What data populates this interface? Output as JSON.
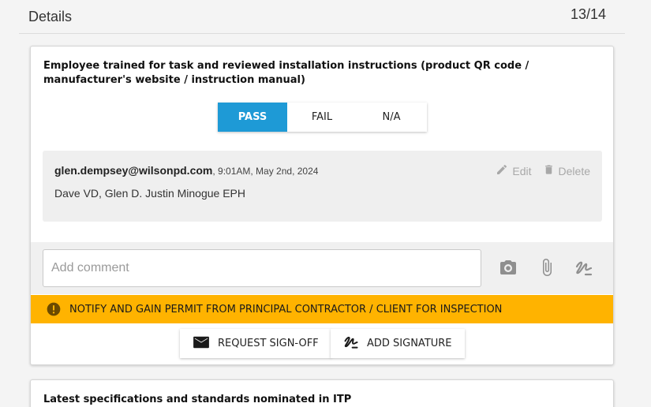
{
  "header": {
    "title": "Details",
    "count": "13/14"
  },
  "item": {
    "question": "Employee trained for task and reviewed installation instructions (product QR code / manufacturer's website / instruction manual)",
    "options": [
      "PASS",
      "FAIL",
      "N/A"
    ],
    "selected_option": "PASS"
  },
  "comment": {
    "author": "glen.dempsey@wilsonpd.com",
    "time": ", 9:01AM, May 2nd, 2024",
    "body": "Dave VD, Glen D. Justin Minogue EPH",
    "edit_label": "Edit",
    "delete_label": "Delete"
  },
  "add_comment": {
    "placeholder": "Add comment"
  },
  "icons": {
    "camera": "camera-icon",
    "attach": "paperclip-icon",
    "signature": "signature-icon",
    "warning": "exclamation-icon",
    "mail": "mail-icon"
  },
  "warning": {
    "text": "NOTIFY AND GAIN PERMIT FROM PRINCIPAL CONTRACTOR / CLIENT FOR INSPECTION"
  },
  "buttons": {
    "request_signoff": "REQUEST SIGN-OFF",
    "add_signature": "ADD SIGNATURE"
  },
  "next_item": {
    "question": "Latest specifications and standards nominated in ITP"
  },
  "colors": {
    "accent": "#1e9ad6",
    "warning": "#ffb300",
    "muted": "#a8a8a8"
  }
}
